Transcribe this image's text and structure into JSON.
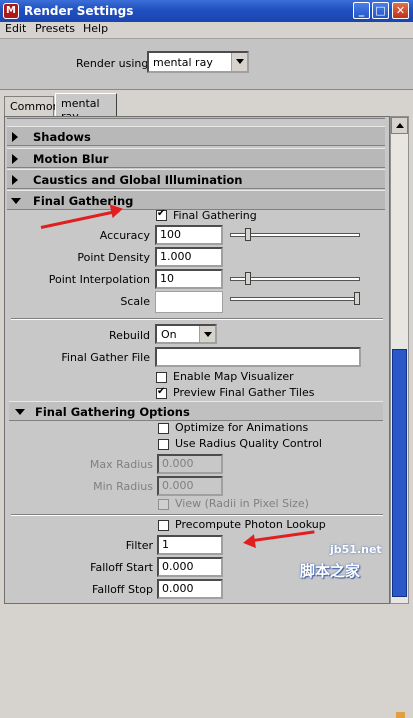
{
  "window": {
    "title": "Render Settings"
  },
  "menu": [
    "Edit",
    "Presets",
    "Help"
  ],
  "render_using": {
    "label": "Render using:",
    "value": "mental ray"
  },
  "tabs": [
    {
      "label": "Common"
    },
    {
      "label": "mental ray"
    }
  ],
  "sections": {
    "shadows": "Shadows",
    "motion_blur": "Motion Blur",
    "caustics": "Caustics and Global Illumination",
    "final_gathering": "Final Gathering"
  },
  "fg": {
    "toggle_label": "Final Gathering",
    "toggle_checked": true,
    "accuracy": {
      "label": "Accuracy",
      "value": "100",
      "slider_fraction": 0.12
    },
    "point_density": {
      "label": "Point Density",
      "value": "1.000"
    },
    "point_interpolation": {
      "label": "Point Interpolation",
      "value": "10",
      "slider_fraction": 0.12
    },
    "scale": {
      "label": "Scale",
      "value": "",
      "slider_fraction": 1.0
    },
    "rebuild": {
      "label": "Rebuild",
      "value": "On"
    },
    "gather_file": {
      "label": "Final Gather File",
      "value": ""
    },
    "enable_map_visualizer": {
      "label": "Enable Map Visualizer",
      "checked": false
    },
    "preview_tiles": {
      "label": "Preview Final Gather Tiles",
      "checked": true
    }
  },
  "fg_options": {
    "title": "Final Gathering Options",
    "optimize": {
      "label": "Optimize for Animations",
      "checked": false
    },
    "radius_quality": {
      "label": "Use Radius Quality Control",
      "checked": false
    },
    "max_radius": {
      "label": "Max Radius",
      "value": "0.000"
    },
    "min_radius": {
      "label": "Min Radius",
      "value": "0.000"
    },
    "view_pixel": {
      "label": "View (Radii in Pixel Size)",
      "checked": false
    },
    "precompute": {
      "label": "Precompute Photon Lookup",
      "checked": false
    },
    "filter": {
      "label": "Filter",
      "value": "1"
    },
    "falloff_start": {
      "label": "Falloff Start",
      "value": "0.000"
    },
    "falloff_stop": {
      "label": "Falloff Stop",
      "value": "0.000"
    }
  },
  "watermark": {
    "url": "jb51.net",
    "text": "脚本之家"
  },
  "colors": {
    "titlebar": "#2050c0",
    "annotation_arrow": "#e02020",
    "scroll_thumb": "#2a58c8"
  }
}
